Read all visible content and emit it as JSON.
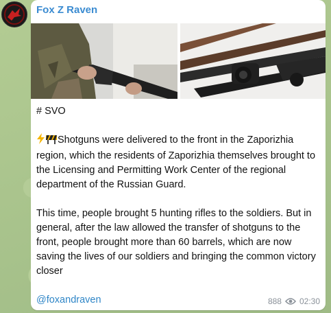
{
  "channel": {
    "name": "Fox Z Raven"
  },
  "post": {
    "hashtag": "# SVO",
    "paragraph1_emoji_icons": [
      "lightning-icon",
      "roadblock-icon"
    ],
    "paragraph1": "Shotguns were delivered to the front in the Zaporizhia region, which the residents of Zaporizhia themselves brought to the Licensing and Permitting Work Center of the regional department of the Russian Guard.",
    "paragraph2": "This time, people brought 5 hunting rifles to the soldiers. But in general, after the law allowed the transfer of shotguns to the front, people brought more than 60 barrels, which are now saving the lives of our soldiers and bringing the common victory closer",
    "signature_link": "@foxandraven"
  },
  "meta": {
    "views": "888",
    "time": "02:30"
  },
  "colors": {
    "sender": "#3a8bd1",
    "link": "#2f86c7",
    "meta": "#8a9199",
    "bubble": "#ffffff",
    "wallpaper": "#a7c28f"
  }
}
